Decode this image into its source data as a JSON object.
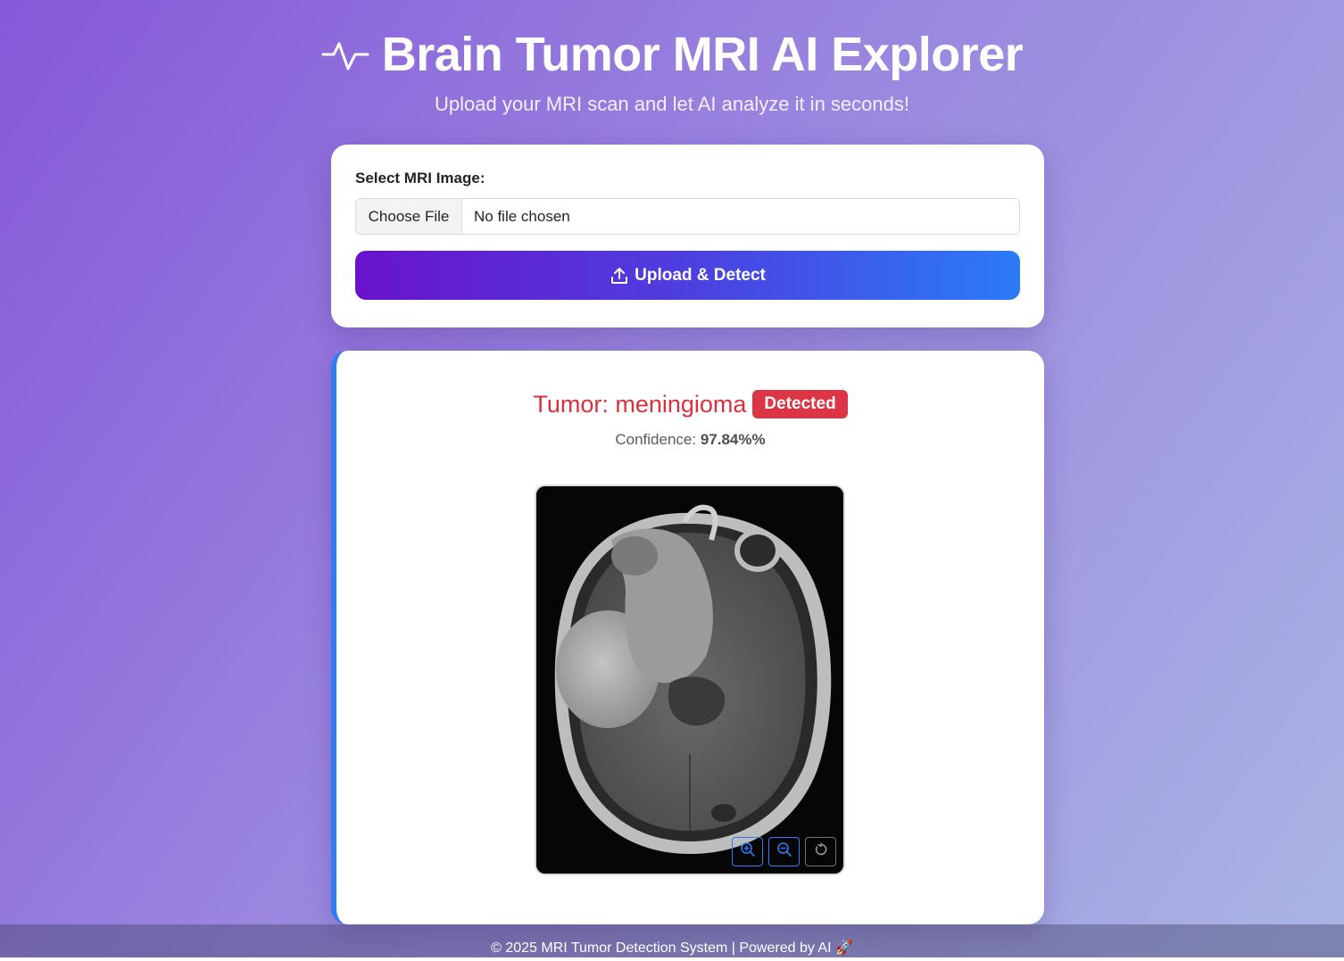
{
  "header": {
    "icon": "activity-pulse-icon",
    "title": "Brain Tumor MRI AI Explorer",
    "subtitle": "Upload your MRI scan and let AI analyze it in seconds!"
  },
  "upload": {
    "label": "Select MRI Image:",
    "choose_file_label": "Choose File",
    "file_status": "No file chosen",
    "button_icon": "upload-icon",
    "button_label": "Upload & Detect"
  },
  "result": {
    "tumor_prefix": "Tumor: ",
    "tumor_type": "meningioma",
    "badge": "Detected",
    "confidence_label": "Confidence: ",
    "confidence_value": "97.84%%",
    "controls": [
      "zoom-in-icon",
      "zoom-out-icon",
      "reset-icon"
    ]
  },
  "footer": {
    "text": "© 2025 MRI Tumor Detection System | Powered by AI 🚀"
  },
  "colors": {
    "accent_gradient_start": "#6a12cc",
    "accent_gradient_end": "#2a7bf8",
    "danger": "#dc3545",
    "result_border": "#2f7cf6"
  }
}
